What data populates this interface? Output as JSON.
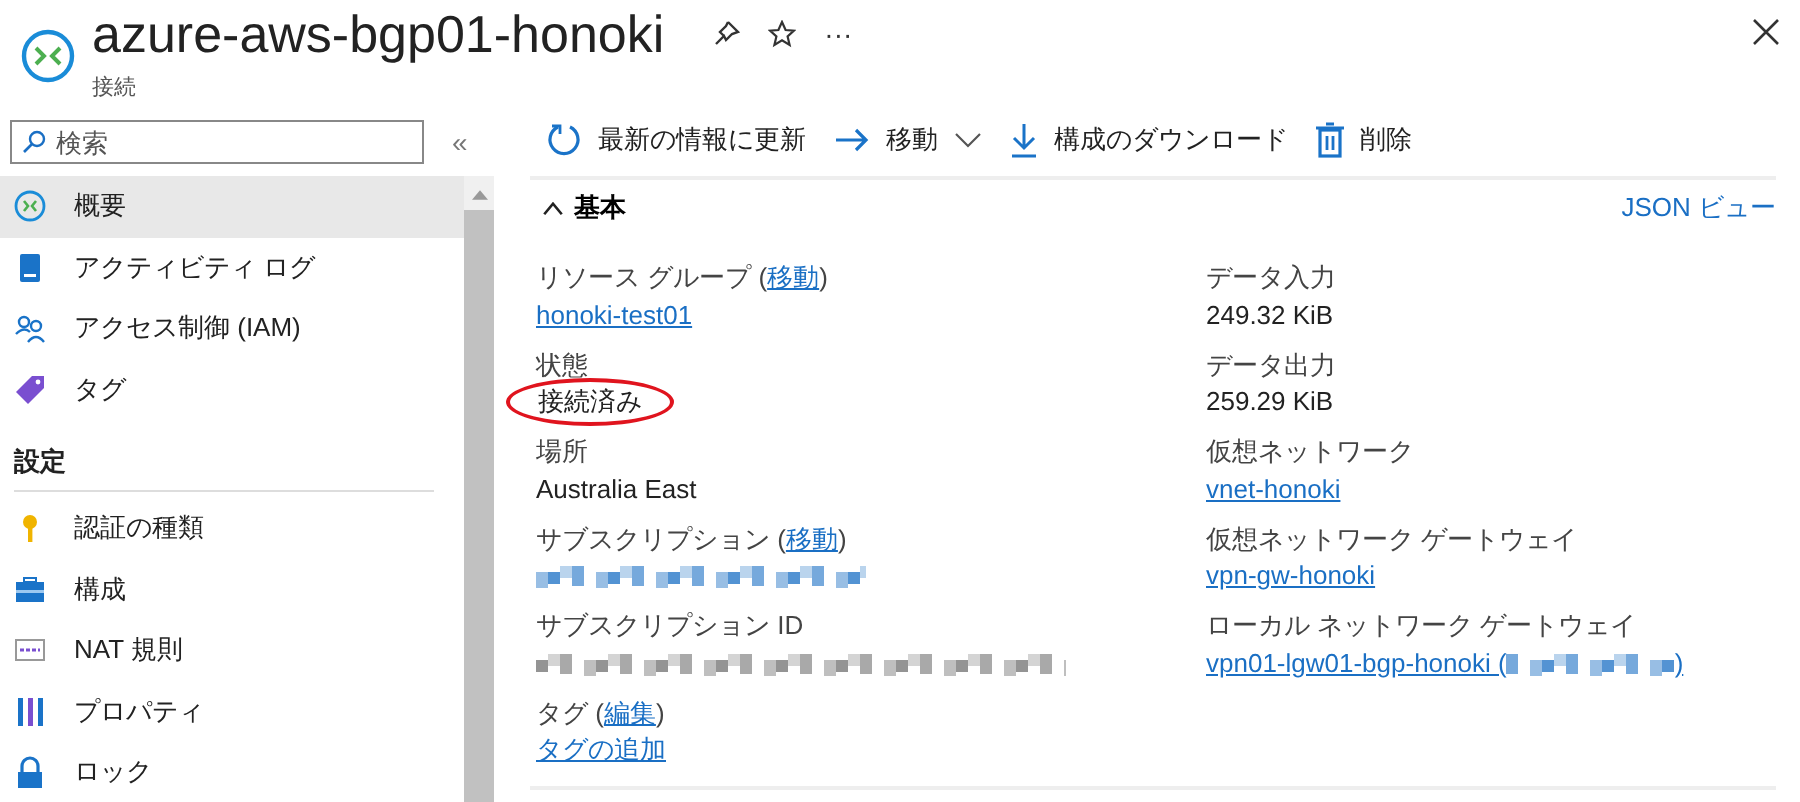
{
  "header": {
    "title": "azure-aws-bgp01-honoki",
    "subtitle": "接続",
    "more": "···"
  },
  "sidebar": {
    "search": {
      "placeholder": "検索"
    },
    "collapse": "«",
    "items": [
      {
        "label": "概要",
        "selected": true
      },
      {
        "label": "アクティビティ ログ",
        "selected": false
      },
      {
        "label": "アクセス制御 (IAM)",
        "selected": false
      },
      {
        "label": "タグ",
        "selected": false
      }
    ],
    "section": "設定",
    "settings_items": [
      {
        "label": "認証の種類",
        "selected": false
      },
      {
        "label": "構成",
        "selected": false
      },
      {
        "label": "NAT 規則",
        "selected": false
      },
      {
        "label": "プロパティ",
        "selected": false
      },
      {
        "label": "ロック",
        "selected": false
      }
    ]
  },
  "toolbar": [
    {
      "label": "最新の情報に更新",
      "kind": "refresh"
    },
    {
      "label": "移動",
      "kind": "move"
    },
    {
      "label": "構成のダウンロード",
      "kind": "download"
    },
    {
      "label": "削除",
      "kind": "delete"
    }
  ],
  "essentials": {
    "heading": "基本",
    "json_link": "JSON ビュー",
    "left": [
      {
        "label": "リソース グループ (",
        "action": "移動",
        "action_suffix": ")",
        "value": "honoki-test01",
        "kind": "link"
      },
      {
        "label": "状態",
        "value": "接続済み",
        "kind": "text",
        "circled": true
      },
      {
        "label": "場所",
        "value": "Australia East",
        "kind": "text"
      },
      {
        "label": "サブスクリプション (",
        "action": "移動",
        "action_suffix": ")",
        "kind": "redacted_link"
      },
      {
        "label": "サブスクリプション ID",
        "kind": "redacted_text"
      },
      {
        "label": "タグ (",
        "action": "編集",
        "action_suffix": ")",
        "value": "タグの追加",
        "kind": "link"
      }
    ],
    "right": [
      {
        "label": "データ入力",
        "value": "249.32 KiB",
        "kind": "text"
      },
      {
        "label": "データ出力",
        "value": "259.29 KiB",
        "kind": "text"
      },
      {
        "label": "仮想ネットワーク",
        "value": "vnet-honoki",
        "kind": "link"
      },
      {
        "label": "仮想ネットワーク ゲートウェイ",
        "value": "vpn-gw-honoki",
        "kind": "link"
      },
      {
        "label": "ローカル ネットワーク ゲートウェイ",
        "value": "vpn01-lgw01-bgp-honoki (",
        "suffix": ")",
        "kind": "link_redacted"
      }
    ]
  }
}
